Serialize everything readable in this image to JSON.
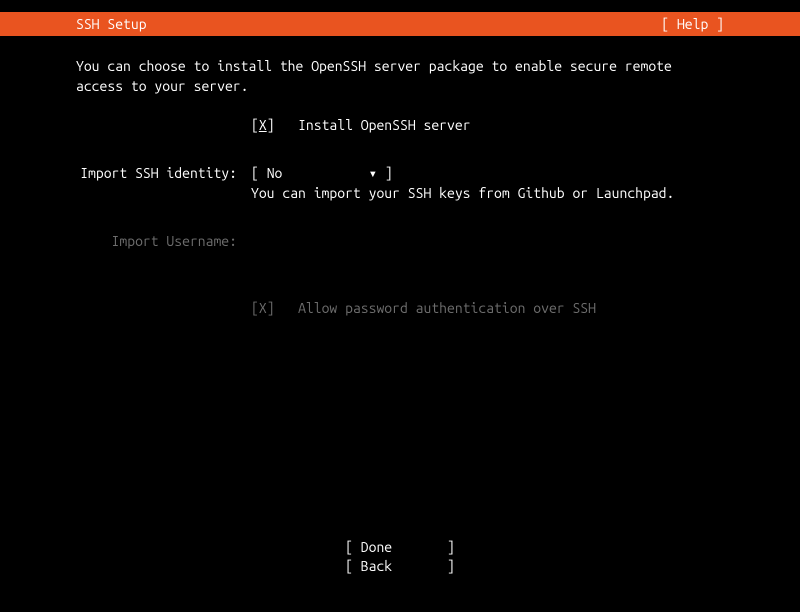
{
  "header": {
    "title": "SSH Setup",
    "help": "[ Help ]"
  },
  "description": "You can choose to install the OpenSSH server package to enable secure remote access to your server.",
  "install_openssh": {
    "checkbox_prefix": "[",
    "checkbox_mark": "X",
    "checkbox_suffix": "]",
    "label": "Install OpenSSH server",
    "checked": true
  },
  "import_identity": {
    "label": "Import SSH identity:",
    "dropdown_prefix": "[ ",
    "value": "No",
    "dropdown_arrow": "▾",
    "dropdown_suffix": " ]",
    "helper": "You can import your SSH keys from Github or Launchpad."
  },
  "import_username": {
    "label": "Import Username:",
    "value": ""
  },
  "allow_password": {
    "checkbox_prefix": "[",
    "checkbox_mark": "X",
    "checkbox_suffix": "]",
    "label": "Allow password authentication over SSH",
    "checked": true
  },
  "footer": {
    "done": "[ Done       ]",
    "back": "[ Back       ]"
  }
}
